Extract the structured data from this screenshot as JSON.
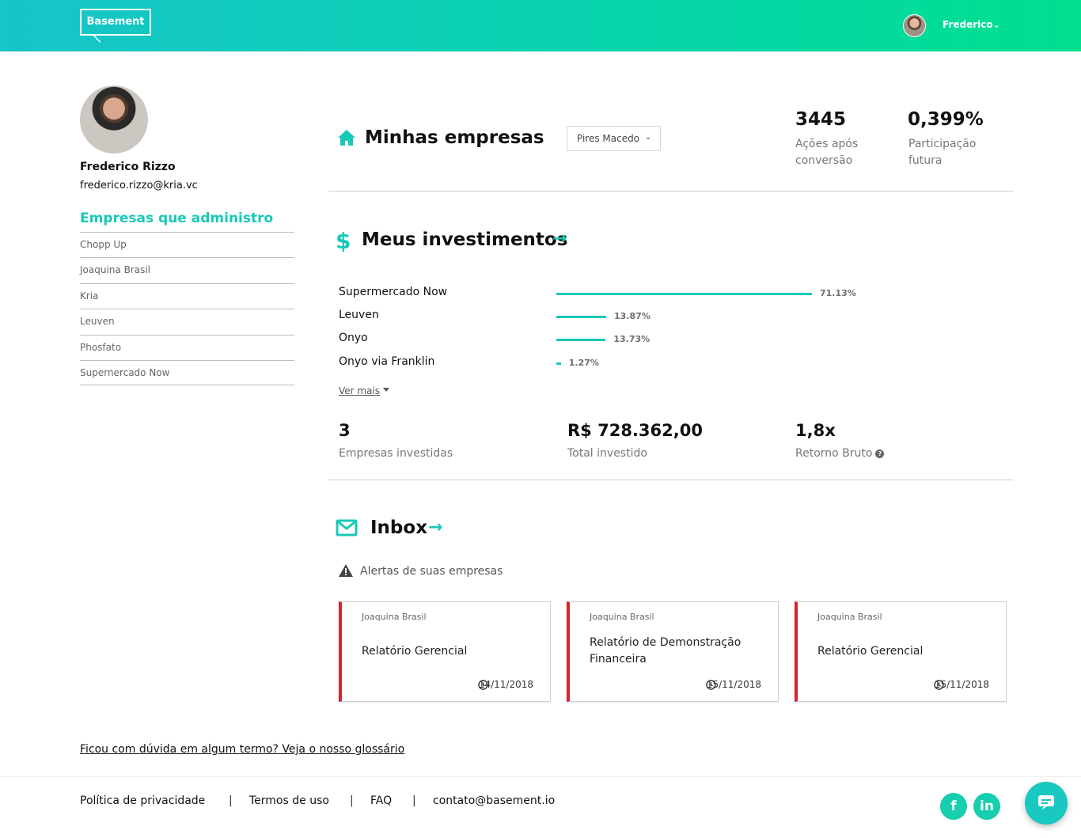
{
  "header": {
    "logo": "Basement",
    "user_name": "Frederico"
  },
  "profile": {
    "name": "Frederico Rizzo",
    "email": "frederico.rizzo@kria.vc"
  },
  "sidebar": {
    "title": "Empresas que administro",
    "items": [
      {
        "label": "Chopp Up"
      },
      {
        "label": "Joaquina Brasil"
      },
      {
        "label": "Kria"
      },
      {
        "label": "Leuven"
      },
      {
        "label": "Phosfato"
      },
      {
        "label": "Supernercado Now"
      }
    ]
  },
  "companies": {
    "title": "Minhas empresas",
    "select_value": "Pires Macedo",
    "stats": [
      {
        "value": "3445",
        "label_line1": "Ações após",
        "label_line2": "conversão"
      },
      {
        "value": "0,399%",
        "label_line1": "Participação",
        "label_line2": "futura"
      }
    ]
  },
  "investments": {
    "title": "Meus investimentos",
    "items": [
      {
        "name": "Supermercado Now",
        "pct_label": "71.13%",
        "pct": 71.13
      },
      {
        "name": "Leuven",
        "pct_label": "13.87%",
        "pct": 13.87
      },
      {
        "name": "Onyo",
        "pct_label": "13.73%",
        "pct": 13.73
      },
      {
        "name": "Onyo via Franklin",
        "pct_label": "1.27%",
        "pct": 1.27
      }
    ],
    "ver_mais": "Ver mais",
    "summary": [
      {
        "value": "3",
        "label": "Empresas investidas"
      },
      {
        "value": "R$ 728.362,00",
        "label": "Total investido"
      },
      {
        "value": "1,8x",
        "label": "Retorno Bruto"
      }
    ]
  },
  "inbox": {
    "title": "Inbox",
    "alerts_title": "Alertas de suas empresas",
    "cards": [
      {
        "company": "Joaquina Brasil",
        "title": "Relatório Gerencial",
        "date": "14/11/2018"
      },
      {
        "company": "Joaquina Brasil",
        "title": "Relatório de Demonstração Financeira",
        "date": "15/11/2018"
      },
      {
        "company": "Joaquina Brasil",
        "title": "Relatório Gerencial",
        "date": "15/11/2018"
      }
    ]
  },
  "glossary": "Ficou com dúvida em algum termo? Veja o nosso glossário",
  "footer": {
    "links": [
      "Política de privacidade",
      "Termos de uso",
      "FAQ",
      "contato@basement.io"
    ],
    "separator": "|",
    "social": [
      "f",
      "in"
    ]
  },
  "colors": {
    "accent": "#18c9b7",
    "alert": "#d3262f",
    "header_start": "#17c4c9",
    "header_end": "#00e08f"
  }
}
